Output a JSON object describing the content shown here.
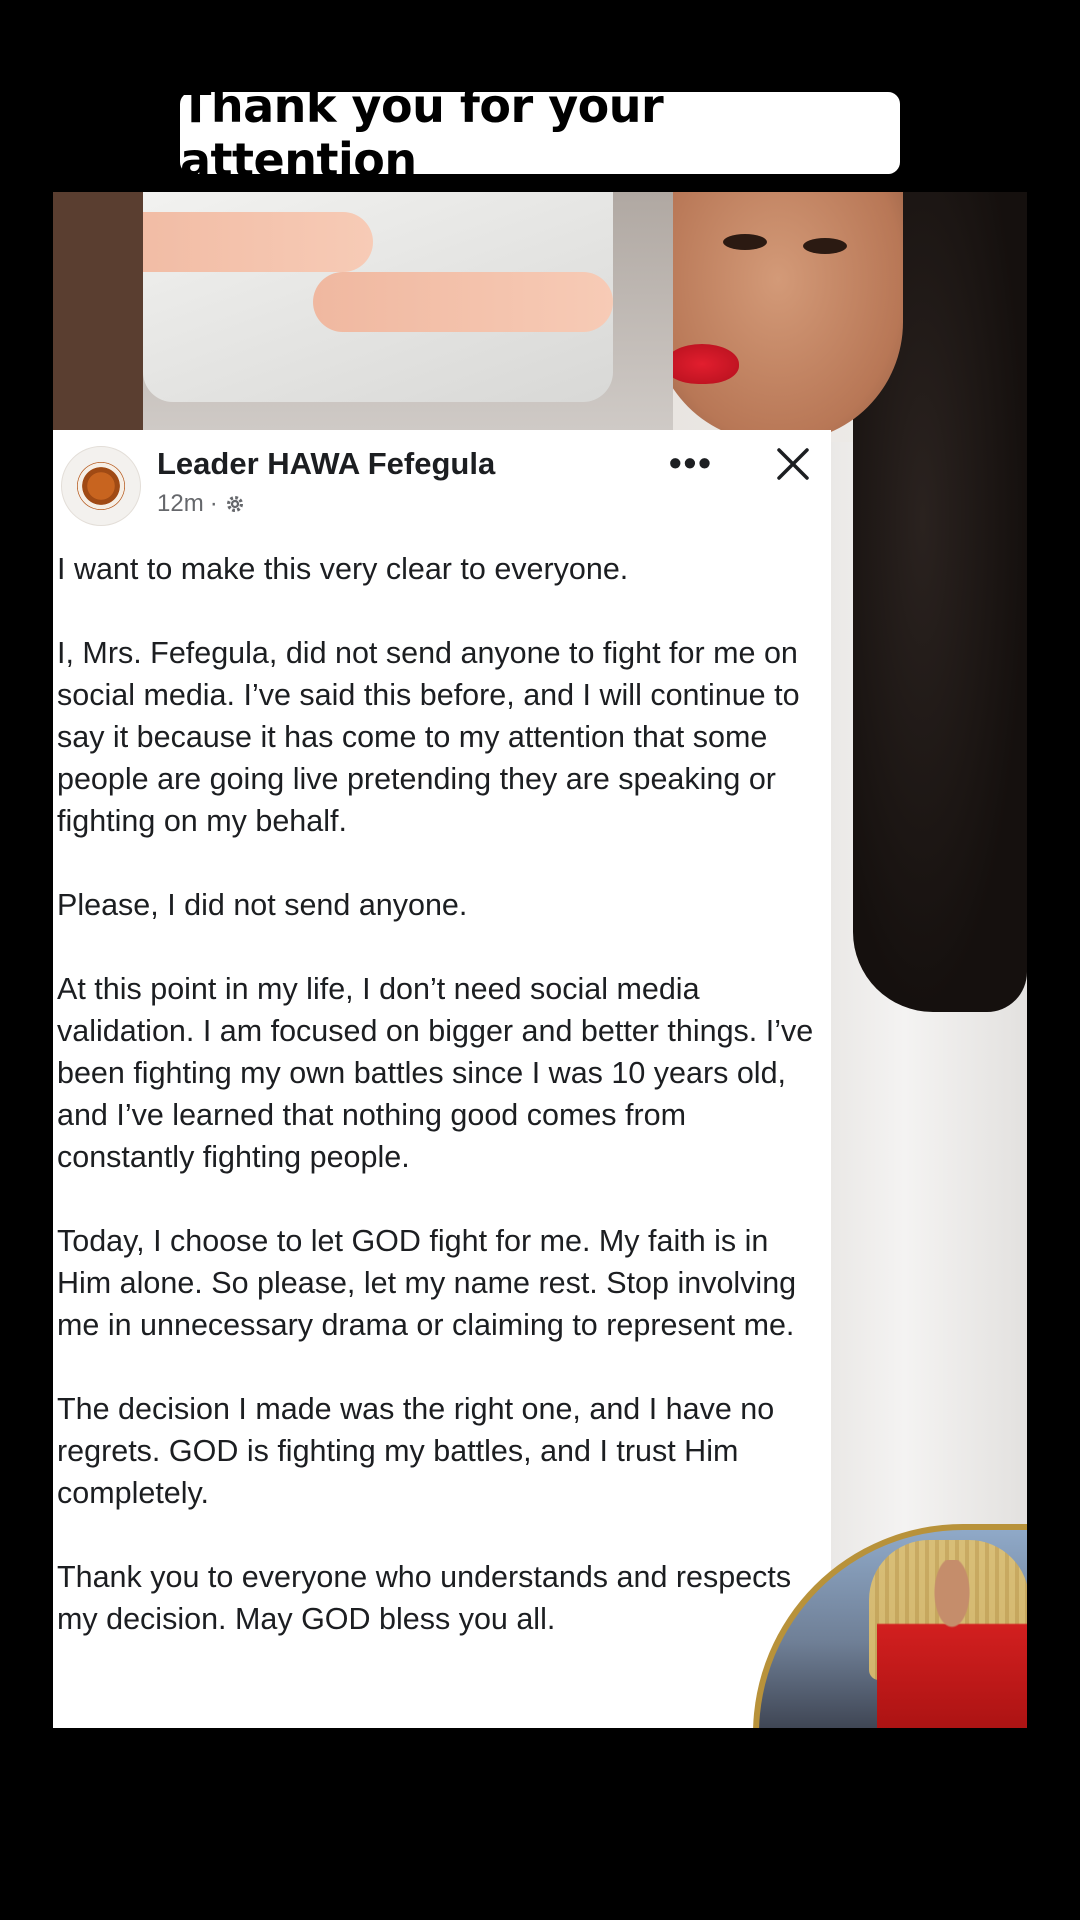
{
  "caption": "Thank you for your attention",
  "post": {
    "author": "Leader HAWA Fefegula",
    "time": "12m",
    "separator": "·",
    "paragraphs": [
      "I want to make this very clear to everyone.",
      "I, Mrs. Fefegula, did not send anyone to fight for me on social media. I’ve said this before, and I will continue to say it because it has come to my attention that some people are going live pretending they are speaking or fighting on my behalf.",
      "Please, I did not send anyone.",
      "At this point in my life, I don’t need social media validation. I am focused on bigger and better things. I’ve been fighting my own battles since I was 10 years old, and I’ve learned that nothing good comes from constantly fighting people.",
      "Today, I choose to let GOD fight for me. My faith is in Him alone. So please, let my name rest. Stop involving me in unnecessary drama or claiming to represent me.",
      "The decision I made was the right one, and I have no regrets. GOD is fighting my battles, and I trust Him completely.",
      "Thank you to everyone who understands and respects my decision. May GOD bless you all."
    ],
    "more_icon": "more-horizontal-icon",
    "close_icon": "close-icon",
    "privacy_icon": "gear-icon"
  }
}
